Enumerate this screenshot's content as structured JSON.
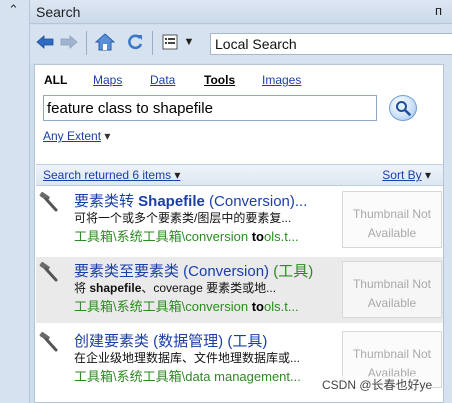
{
  "window": {
    "title": "Search",
    "pin_glyph": "ᴨ"
  },
  "toolbar": {
    "location": "Local Search"
  },
  "tabs": {
    "all": "ALL",
    "maps": "Maps",
    "data": "Data",
    "tools_prefix": "T",
    "tools_rest": "ools",
    "images": "Images"
  },
  "search": {
    "value": "feature class to shapefile"
  },
  "extent": {
    "label": "Any Extent",
    "caret": "▾"
  },
  "results_header": {
    "count": "Search returned 6 items",
    "caret": "▾",
    "sort": "Sort By",
    "sort_caret": "▾"
  },
  "results": [
    {
      "t1": "要素类转 ",
      "t2": "Shapefile",
      "t3": " (Conversion)...",
      "d1": "可将一个或多个要素类/图层中的要素复...",
      "d2": "",
      "d3": "",
      "p1": "工具箱\\系统工具箱\\conversion ",
      "p2": "to",
      "p3": "ols.t...",
      "thumb": "Thumbnail Not Available"
    },
    {
      "t1": "要素类至要素类 (Conversion) ",
      "t2": "(工具)",
      "t3": "",
      "d1": "将 ",
      "d2": "shapefile",
      "d3": "、coverage 要素类或地...",
      "p1": "工具箱\\系统工具箱\\conversion ",
      "p2": "to",
      "p3": "ols.t...",
      "thumb": "Thumbnail Not Available"
    },
    {
      "t1": "创建要素类 (数据管理) (工具)",
      "t2": "",
      "t3": "",
      "d1": "在企业级地理数据库、文件地理数据库或...",
      "d2": "",
      "d3": "",
      "p1": "工具箱\\系统工具箱\\data management...",
      "p2": "",
      "p3": "",
      "thumb": "Thumbnail Not Available"
    }
  ],
  "watermark": "CSDN @长春也好ye",
  "colors": {
    "link": "#1a3fa8",
    "path_green": "#2e8a22",
    "tool_label_green": "#2e8a22",
    "selected_bg": "#eaeaea",
    "panel_bg": "#d6e2ef"
  },
  "icons": [
    "collapse-arrow-icon",
    "back-arrow-icon",
    "forward-arrow-icon",
    "home-icon",
    "refresh-icon",
    "view-list-icon",
    "search-magnifier-icon",
    "hammer-tool-icon"
  ]
}
